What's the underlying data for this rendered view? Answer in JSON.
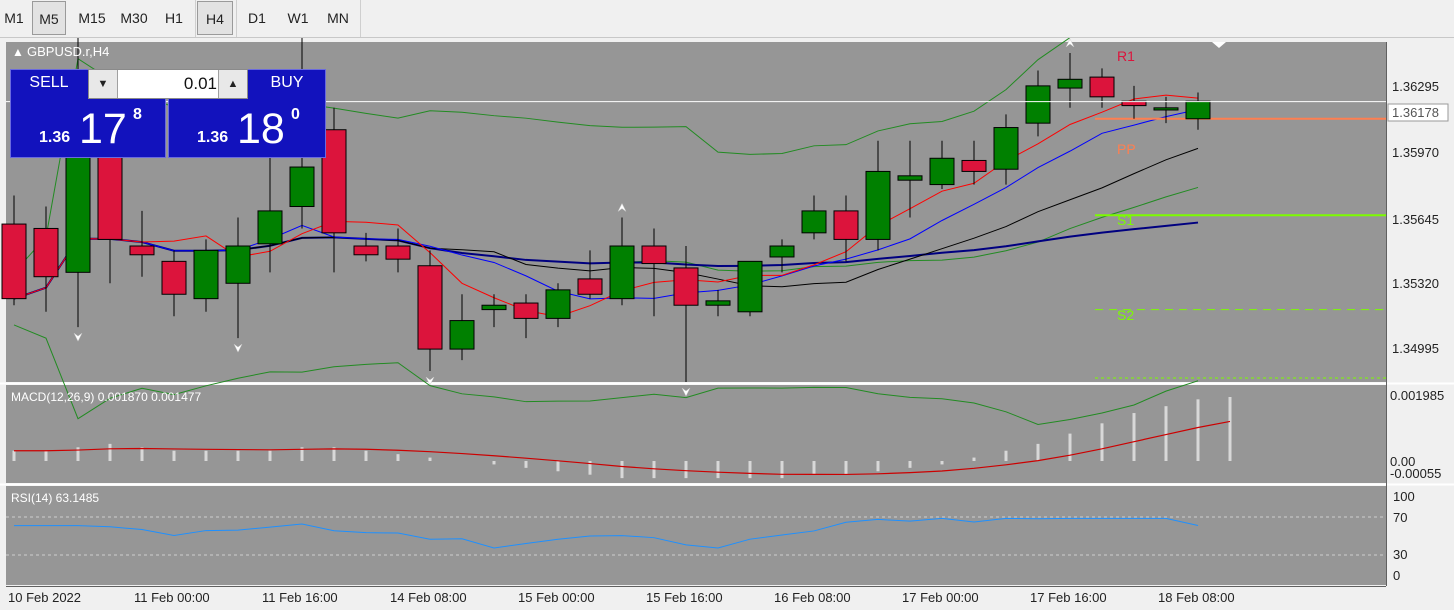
{
  "timeframes": [
    "M1",
    "M5",
    "M15",
    "M30",
    "H1",
    "H4",
    "D1",
    "W1",
    "MN"
  ],
  "active_timeframes": [
    "M5",
    "H4"
  ],
  "chart_title": "GBPUSD.r,H4",
  "trade_panel": {
    "sell_label": "SELL",
    "buy_label": "BUY",
    "lot": "0.01",
    "sell_small": "1.36",
    "sell_big": "17",
    "sell_sup": "8",
    "buy_small": "1.36",
    "buy_big": "18",
    "buy_sup": "0"
  },
  "price_axis": {
    "labels": [
      "1.36295",
      "1.35970",
      "1.35645",
      "1.35320",
      "1.34995"
    ],
    "current_price": "1.36178"
  },
  "pivot_labels": [
    "R1",
    "PP",
    "S1",
    "S2"
  ],
  "macd": {
    "title": "MACD(12,26,9) 0.001870 0.001477",
    "axis_labels": [
      "0.001985",
      "0.00",
      "-0.00055"
    ]
  },
  "rsi": {
    "title": "RSI(14) 63.1485",
    "axis_labels": [
      "100",
      "70",
      "30",
      "0"
    ]
  },
  "time_axis": [
    "10 Feb 2022",
    "11 Feb 00:00",
    "11 Feb 16:00",
    "14 Feb 08:00",
    "15 Feb 00:00",
    "15 Feb 16:00",
    "16 Feb 08:00",
    "17 Feb 00:00",
    "17 Feb 16:00",
    "18 Feb 08:00"
  ],
  "colors": {
    "background": "#969696",
    "bull": "#008000",
    "bear": "#dc143c",
    "ma_fast": "#ff0000",
    "ma_blue": "#0000ff",
    "ma_black": "#000000",
    "ma_navy": "#000080",
    "bands": "#228b22",
    "r1": "#dc143c",
    "pp": "#ff7f50",
    "s1": "#7cfc00",
    "panel_blue": "#1212bd"
  },
  "chart_data": {
    "type": "candlestick",
    "symbol": "GBPUSD.r",
    "timeframe": "H4",
    "ylim": [
      1.349,
      1.365
    ],
    "candles": [
      {
        "o": 1.3562,
        "h": 1.3575,
        "l": 1.3525,
        "c": 1.3528
      },
      {
        "o": 1.356,
        "h": 1.357,
        "l": 1.3522,
        "c": 1.3538
      },
      {
        "o": 1.354,
        "h": 1.365,
        "l": 1.3515,
        "c": 1.36
      },
      {
        "o": 1.3605,
        "h": 1.362,
        "l": 1.3535,
        "c": 1.3555
      },
      {
        "o": 1.3552,
        "h": 1.3568,
        "l": 1.3538,
        "c": 1.3548
      },
      {
        "o": 1.3545,
        "h": 1.355,
        "l": 1.352,
        "c": 1.353
      },
      {
        "o": 1.3528,
        "h": 1.3555,
        "l": 1.3522,
        "c": 1.355
      },
      {
        "o": 1.3535,
        "h": 1.3565,
        "l": 1.351,
        "c": 1.3552
      },
      {
        "o": 1.3553,
        "h": 1.36,
        "l": 1.354,
        "c": 1.3568
      },
      {
        "o": 1.357,
        "h": 1.365,
        "l": 1.356,
        "c": 1.3588
      },
      {
        "o": 1.3605,
        "h": 1.3615,
        "l": 1.354,
        "c": 1.3558
      },
      {
        "o": 1.3552,
        "h": 1.3558,
        "l": 1.3545,
        "c": 1.3548
      },
      {
        "o": 1.3552,
        "h": 1.356,
        "l": 1.354,
        "c": 1.3546
      },
      {
        "o": 1.3543,
        "h": 1.355,
        "l": 1.3495,
        "c": 1.3505
      },
      {
        "o": 1.3505,
        "h": 1.353,
        "l": 1.35,
        "c": 1.3518
      },
      {
        "o": 1.3523,
        "h": 1.353,
        "l": 1.3515,
        "c": 1.3525
      },
      {
        "o": 1.3526,
        "h": 1.353,
        "l": 1.351,
        "c": 1.3519
      },
      {
        "o": 1.3519,
        "h": 1.3535,
        "l": 1.3515,
        "c": 1.3532
      },
      {
        "o": 1.3537,
        "h": 1.355,
        "l": 1.3528,
        "c": 1.353
      },
      {
        "o": 1.3528,
        "h": 1.3565,
        "l": 1.3525,
        "c": 1.3552
      },
      {
        "o": 1.3552,
        "h": 1.356,
        "l": 1.352,
        "c": 1.3544
      },
      {
        "o": 1.3542,
        "h": 1.3552,
        "l": 1.349,
        "c": 1.3525
      },
      {
        "o": 1.3525,
        "h": 1.3532,
        "l": 1.352,
        "c": 1.3527
      },
      {
        "o": 1.3522,
        "h": 1.3545,
        "l": 1.352,
        "c": 1.3545
      },
      {
        "o": 1.3547,
        "h": 1.3555,
        "l": 1.354,
        "c": 1.3552
      },
      {
        "o": 1.3558,
        "h": 1.3575,
        "l": 1.3555,
        "c": 1.3568
      },
      {
        "o": 1.3568,
        "h": 1.3575,
        "l": 1.3545,
        "c": 1.3555
      },
      {
        "o": 1.3555,
        "h": 1.36,
        "l": 1.355,
        "c": 1.3586
      },
      {
        "o": 1.3582,
        "h": 1.36,
        "l": 1.3565,
        "c": 1.3584
      },
      {
        "o": 1.358,
        "h": 1.36,
        "l": 1.3578,
        "c": 1.3592
      },
      {
        "o": 1.3591,
        "h": 1.36,
        "l": 1.358,
        "c": 1.3586
      },
      {
        "o": 1.3587,
        "h": 1.3612,
        "l": 1.358,
        "c": 1.3606
      },
      {
        "o": 1.3608,
        "h": 1.3632,
        "l": 1.3602,
        "c": 1.3625
      },
      {
        "o": 1.3624,
        "h": 1.364,
        "l": 1.3615,
        "c": 1.3628
      },
      {
        "o": 1.3629,
        "h": 1.3633,
        "l": 1.3615,
        "c": 1.362
      },
      {
        "o": 1.3618,
        "h": 1.3625,
        "l": 1.361,
        "c": 1.3616
      },
      {
        "o": 1.3614,
        "h": 1.362,
        "l": 1.3608,
        "c": 1.3615
      },
      {
        "o": 1.361,
        "h": 1.3622,
        "l": 1.3605,
        "c": 1.3618
      }
    ],
    "pivot_levels": {
      "R1": 1.3648,
      "PP": 1.361,
      "S1": 1.3566,
      "S2": 1.3523
    },
    "current_price": 1.36178,
    "macd_values": [
      0.0003,
      0.0003,
      0.0004,
      0.0005,
      0.0004,
      0.0003,
      0.0003,
      0.0003,
      0.0003,
      0.0004,
      0.0004,
      0.0003,
      0.0002,
      0.0001,
      0.0,
      -0.0001,
      -0.0002,
      -0.0003,
      -0.0004,
      -0.0005,
      -0.0005,
      -0.0005,
      -0.0005,
      -0.0005,
      -0.0005,
      -0.0004,
      -0.0004,
      -0.0003,
      -0.0002,
      -0.0001,
      0.0001,
      0.0003,
      0.0005,
      0.0008,
      0.0011,
      0.0014,
      0.0016,
      0.0018,
      0.00187
    ],
    "macd_signal_last": 0.001477,
    "rsi_last": 63.1485
  }
}
